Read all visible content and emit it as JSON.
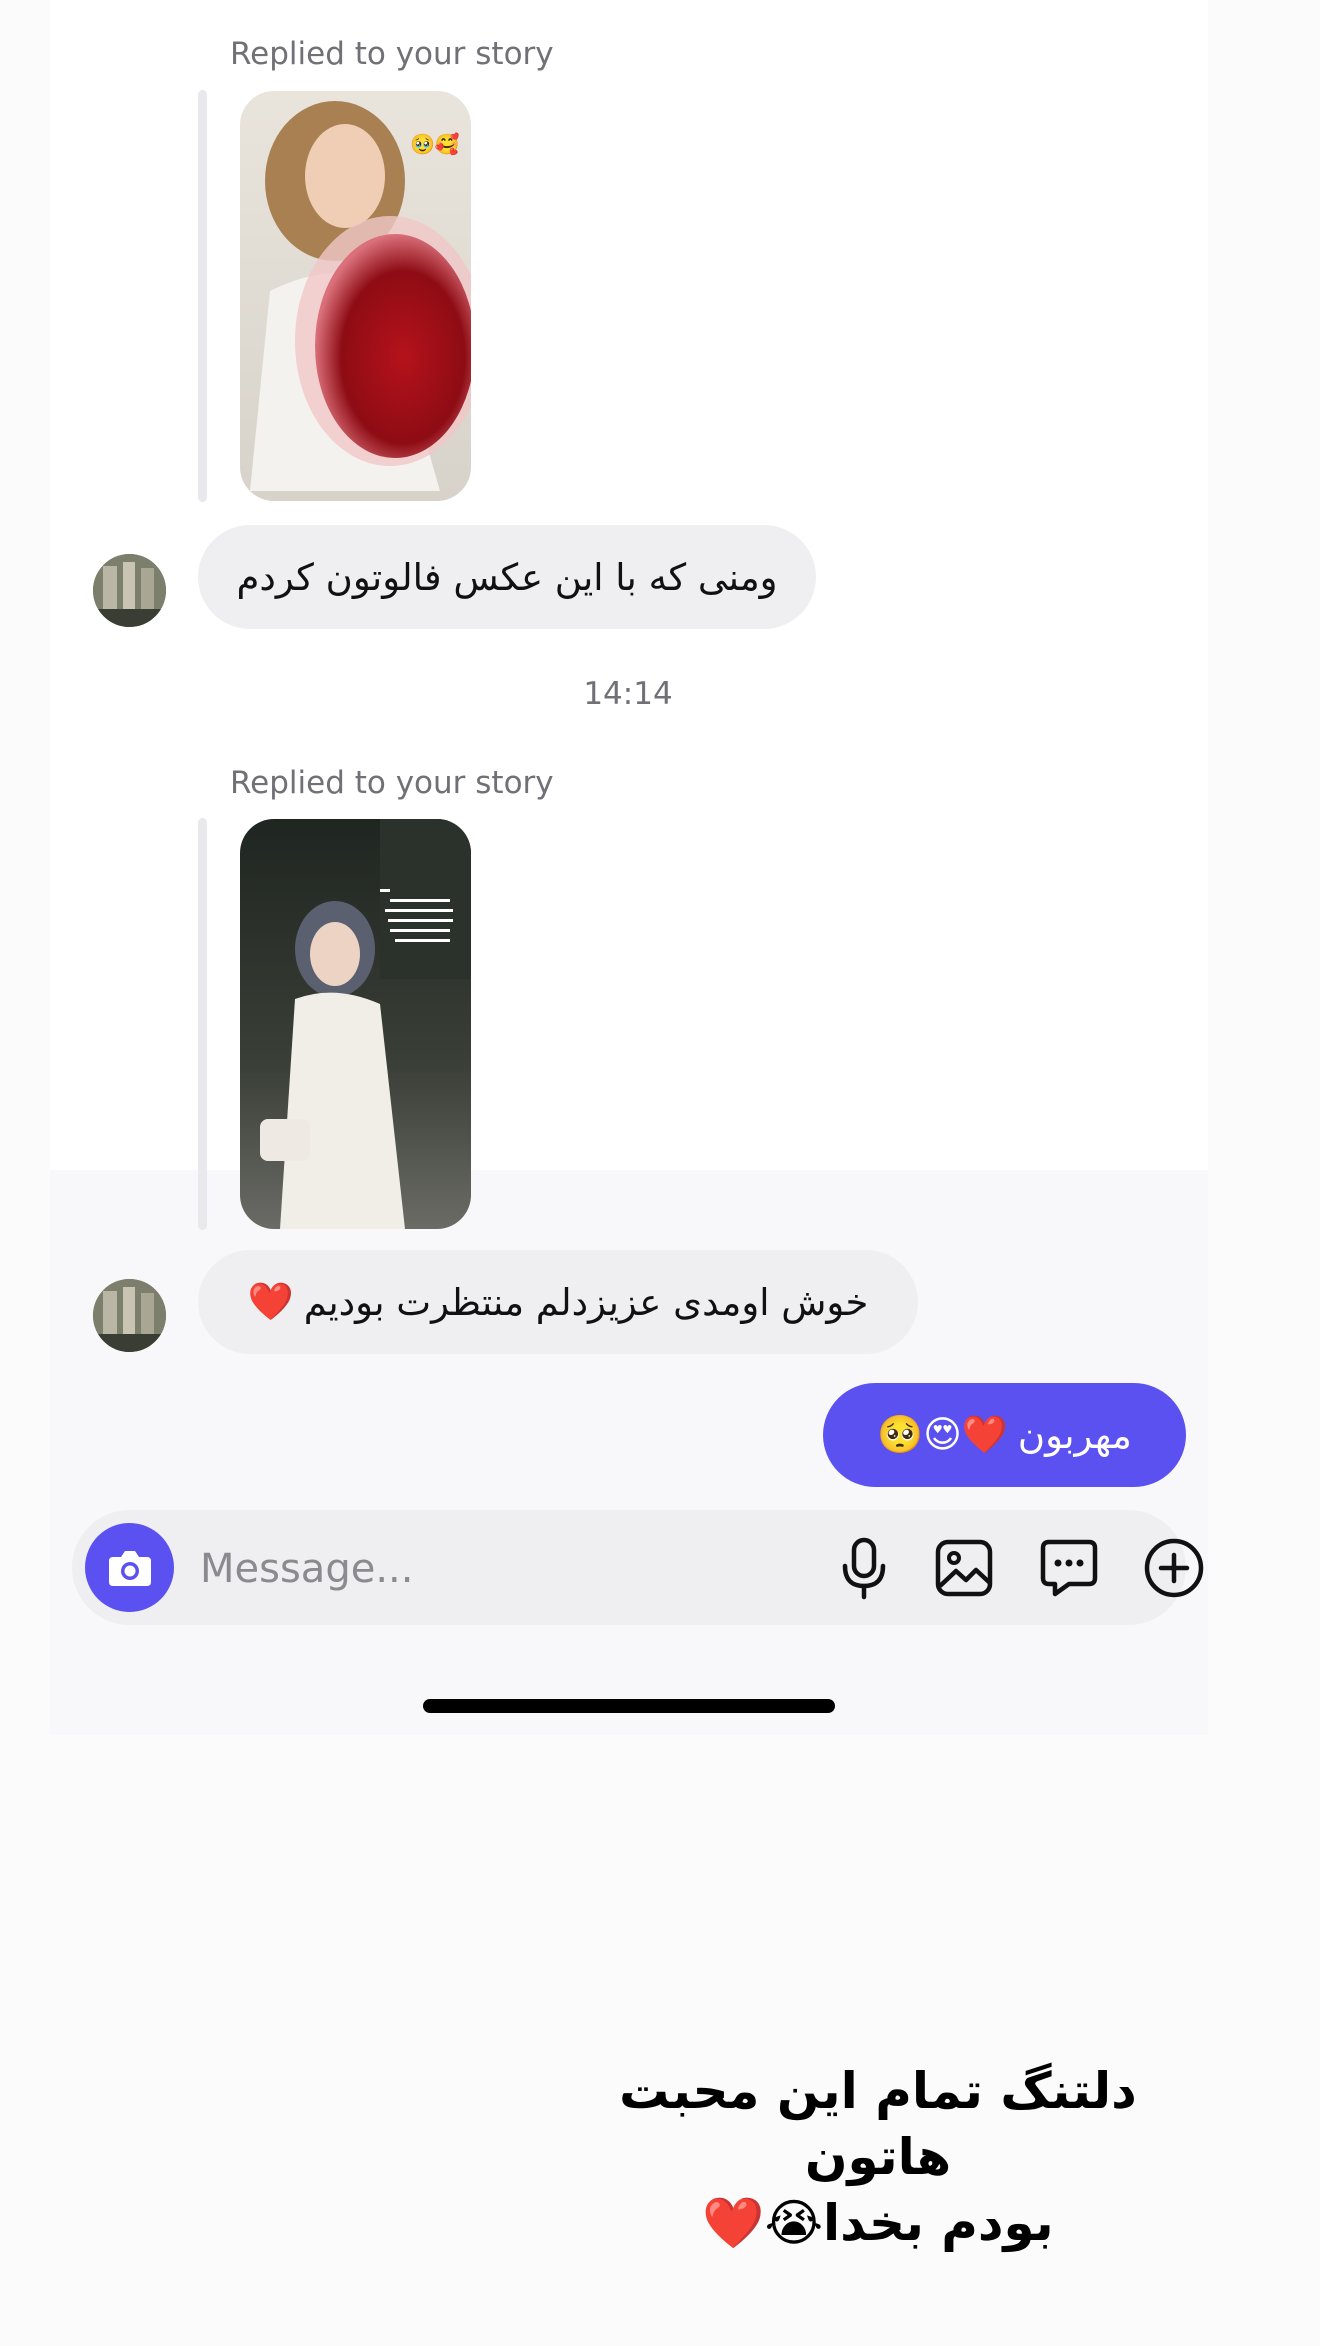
{
  "messages": [
    {
      "replied_label": "Replied to your story",
      "text": "ومنی که با این عکس فالوتون کردم",
      "story_emoji": "🥹🥰"
    },
    {
      "replied_label": "Replied to your story",
      "text": "خوش اومدی عزیزدلم منتظرت بودیم",
      "heart": "❤️"
    }
  ],
  "timestamp": "14:14",
  "outgoing": {
    "text": "مهربون",
    "emojis": "❤️😍🥺"
  },
  "composer": {
    "placeholder": "Message..."
  },
  "icons": {
    "camera": "camera-icon",
    "mic": "microphone-icon",
    "gallery": "gallery-icon",
    "sticker": "chat-sticker-icon",
    "add": "plus-circle-icon"
  },
  "caption": {
    "line1": "دلتنگ تمام این محبت هاتون",
    "line2": "بودم بخدا😭❤️"
  },
  "colors": {
    "accent": "#5b51f0",
    "bubble_in": "#efeff2",
    "meta_text": "#707076"
  }
}
